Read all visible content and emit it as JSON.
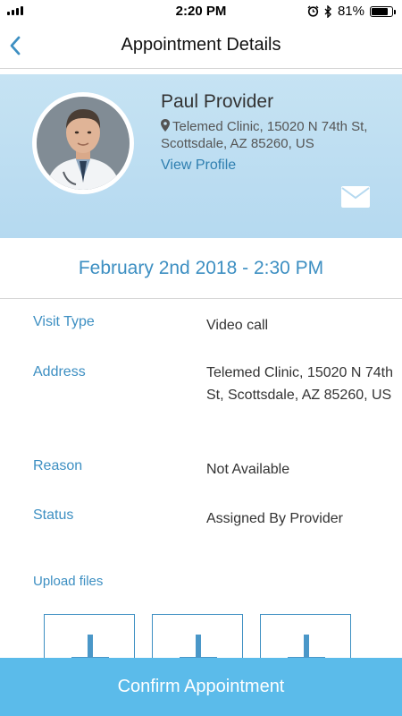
{
  "status_bar": {
    "time": "2:20 PM",
    "battery": "81%",
    "battery_level": 0.81
  },
  "nav": {
    "title": "Appointment Details"
  },
  "provider": {
    "name": "Paul Provider",
    "location": "Telemed Clinic, 15020 N 74th St, Scottsdale, AZ 85260, US",
    "view_profile": "View Profile"
  },
  "appointment": {
    "datetime": "February 2nd 2018 - 2:30 PM",
    "details": [
      {
        "label": "Visit Type",
        "value": "Video call"
      },
      {
        "label": "Address",
        "value": "Telemed Clinic, 15020 N 74th St, Scottsdale, AZ 85260, US"
      },
      {
        "label": "Reason",
        "value": "Not Available"
      },
      {
        "label": "Status",
        "value": "Assigned By Provider"
      }
    ]
  },
  "upload": {
    "title": "Upload files"
  },
  "confirm_label": "Confirm Appointment",
  "colors": {
    "accent": "#3d8fc2",
    "button": "#5bbbea",
    "card": "#c6e3f3"
  },
  "icons": [
    "signal-icon",
    "alarm-icon",
    "bluetooth-icon",
    "battery-icon",
    "back-chevron-icon",
    "location-pin-icon",
    "mail-icon",
    "upload-plus-icon"
  ]
}
